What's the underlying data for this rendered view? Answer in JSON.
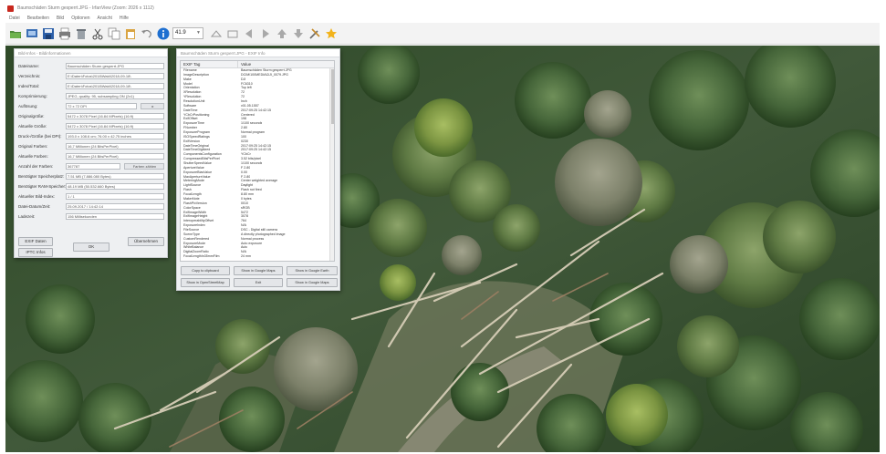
{
  "app": {
    "title": "Baumschäden Sturm gesperrt.JPG - IrfanView (Zoom: 2026 x 1112)"
  },
  "menu": [
    "Datei",
    "Bearbeiten",
    "Bild",
    "Optionen",
    "Ansicht",
    "Hilfe"
  ],
  "toolbar": {
    "zoom_value": "41.9",
    "icons": [
      "open-folder-icon",
      "slideshow-icon",
      "save-icon",
      "print-icon",
      "delete-icon",
      "cut-icon",
      "copy-icon",
      "paste-icon",
      "undo-icon",
      "info-icon",
      "zoom-in-icon",
      "zoom-out-icon",
      "prev-icon",
      "next-icon",
      "first-icon",
      "last-icon",
      "settings-icon",
      "favorite-icon"
    ]
  },
  "props_window": {
    "title": "Bild-Infos - Bildinformationen",
    "fields": [
      {
        "label": "Dateiname:",
        "value": "Baumschäden Sturm gesperrt.JPG"
      },
      {
        "label": "Verzeichnis:",
        "value": "E:\\Daten\\Fotos\\2018\\Wald\\2018-09-18\\"
      },
      {
        "label": "Index/Total:",
        "value": "E:\\Daten\\Fotos\\2018\\Wald\\2018-09-18\\"
      },
      {
        "label": "Komprimierung:",
        "value": "JPEG, quality: 95, subsampling ON (2x1)"
      },
      {
        "label": "Auflösung:",
        "value": "72 x 72 DPI"
      },
      {
        "label": "Originalgröße:",
        "value": "5472 x 3078  Pixel (16.84 MPixels) (16:9)"
      },
      {
        "label": "Aktuelle Größe:",
        "value": "5472 x 3078  Pixel (16.84 MPixels) (16:9)"
      },
      {
        "label": "Druck-/Größe (bei DPI):",
        "value": "193.0 x 108.6 cm; 76.00 x 42.75 inches"
      },
      {
        "label": "Original Farben:",
        "value": "16,7 Millionen   (24 BitsPerPixel)"
      },
      {
        "label": "Aktuelle Farben:",
        "value": "16,7 Millionen   (24 BitsPerPixel)"
      },
      {
        "label": "Anzahl der Farben:",
        "value": "367787"
      },
      {
        "label": "Benötigter Speicherplatz:",
        "value": "7.51 MB (7.886.080 Bytes)"
      },
      {
        "label": "Benötigter RAM-Speicher:",
        "value": "48.19 MB (50.532.660 Bytes)"
      },
      {
        "label": "Aktueller Bild-Index:",
        "value": "1 / 1"
      },
      {
        "label": "Datei-Datum/Zeit:",
        "value": "25.09.2017 / 14:42:14"
      },
      {
        "label": "Ladezeit:",
        "value": "156 Millisekunden"
      }
    ],
    "count_colors_label": "Farben zählen",
    "buttons": {
      "exif": "EXIF Daten",
      "iptc": "IPTC Infos",
      "ok": "OK",
      "change": "Übernehmen"
    }
  },
  "exif_window": {
    "title": "Baumschäden Sturm gesperrt.JPG - EXIF Info",
    "columns": [
      "EXIF Tag",
      "Value"
    ],
    "rows": [
      [
        "Filename",
        "Baumschäden Sturm gesperrt.JPG"
      ],
      [
        "ImageDescription",
        "DCIM\\100MEDIA\\DJI_0079.JPG"
      ],
      [
        "Make",
        "DJI"
      ],
      [
        "Model",
        "FC6310"
      ],
      [
        "Orientation",
        "Top left"
      ],
      [
        "XResolution",
        "72"
      ],
      [
        "YResolution",
        "72"
      ],
      [
        "ResolutionUnit",
        "Inch"
      ],
      [
        "Software",
        "v01.05.1557"
      ],
      [
        "DateTime",
        "2017:09:25 14:42:15"
      ],
      [
        "YCbCrPositioning",
        "Centered"
      ],
      [
        "ExifOffset",
        "198"
      ],
      [
        "ExposureTime",
        "1/100 seconds"
      ],
      [
        "FNumber",
        "2.80"
      ],
      [
        "ExposureProgram",
        "Normal program"
      ],
      [
        "ISOSpeedRatings",
        "100"
      ],
      [
        "ExifVersion",
        "0230"
      ],
      [
        "DateTimeOriginal",
        "2017:09:25 14:42:15"
      ],
      [
        "DateTimeDigitized",
        "2017:09:25 14:42:15"
      ],
      [
        "ComponentsConfiguration",
        "YCbCr"
      ],
      [
        "CompressedBitsPerPixel",
        "3.52 bits/pixel"
      ],
      [
        "ShutterSpeedValue",
        "1/100 seconds"
      ],
      [
        "ApertureValue",
        "F 2.80"
      ],
      [
        "ExposureBiasValue",
        "0.00"
      ],
      [
        "MaxApertureValue",
        "F 2.80"
      ],
      [
        "MeteringMode",
        "Center weighted average"
      ],
      [
        "LightSource",
        "Daylight"
      ],
      [
        "Flash",
        "Flash not fired"
      ],
      [
        "FocalLength",
        "8.80 mm"
      ],
      [
        "MakerNote",
        "0 bytes"
      ],
      [
        "FlashPixVersion",
        "0010"
      ],
      [
        "ColorSpace",
        "sRGB"
      ],
      [
        "ExifImageWidth",
        "5472"
      ],
      [
        "ExifImageHeight",
        "3078"
      ],
      [
        "InteroperabilityOffset",
        "764"
      ],
      [
        "ExposureIndex",
        "N/A"
      ],
      [
        "FileSource",
        "DSC - Digital still camera"
      ],
      [
        "SceneType",
        "A directly photographed image"
      ],
      [
        "CustomRendered",
        "Normal process"
      ],
      [
        "ExposureMode",
        "Auto exposure"
      ],
      [
        "WhiteBalance",
        "Auto"
      ],
      [
        "DigitalZoomRatio",
        "N/A"
      ],
      [
        "FocalLengthIn35mmFilm",
        "24 mm"
      ],
      [
        "SceneCaptureType",
        "Standard"
      ]
    ],
    "buttons": {
      "copy_clipboard": "Copy to clipboard",
      "show_google": "Show in Google Maps",
      "show_google_earth": "Show in Google Earth",
      "show_openstreet": "Show in OpenStreetMap",
      "exit": "Exit",
      "show_google_alt": "Show in Google Maps"
    }
  }
}
